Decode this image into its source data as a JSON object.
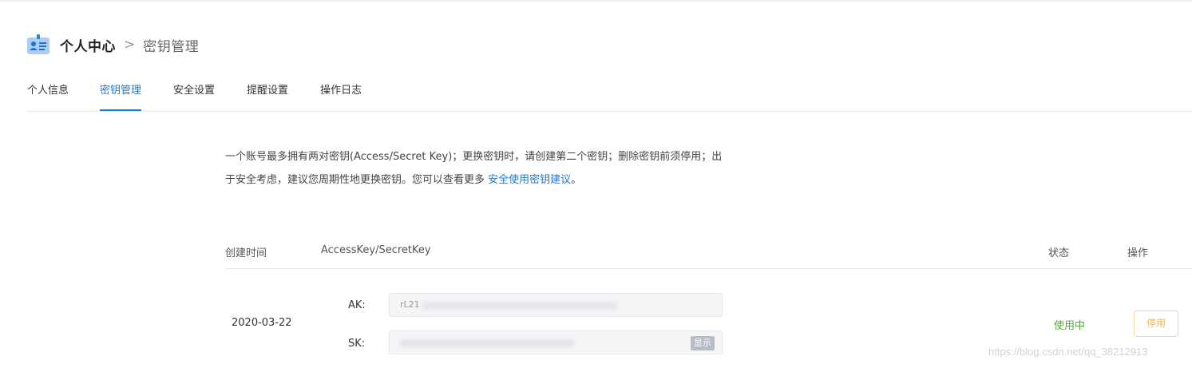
{
  "header": {
    "title": "个人中心",
    "separator": ">",
    "subtitle": "密钥管理",
    "icon": "id-card-icon"
  },
  "tabs": [
    {
      "label": "个人信息",
      "active": false
    },
    {
      "label": "密钥管理",
      "active": true
    },
    {
      "label": "安全设置",
      "active": false
    },
    {
      "label": "提醒设置",
      "active": false
    },
    {
      "label": "操作日志",
      "active": false
    }
  ],
  "notice": {
    "text": "一个账号最多拥有两对密钥(Access/Secret Key)；更换密钥时，请创建第二个密钥；删除密钥前须停用；出于安全考虑，建议您周期性地更换密钥。您可以查看更多 ",
    "link": "安全使用密钥建议",
    "suffix": "。"
  },
  "table": {
    "columns": {
      "created": "创建时间",
      "keys": "AccessKey/SecretKey",
      "status": "状态",
      "actions": "操作"
    },
    "rows": [
      {
        "created": "2020-03-22",
        "ak_label": "AK:",
        "ak_value": "rL21",
        "sk_label": "SK:",
        "sk_show": "显示",
        "status": "使用中",
        "action": "停用"
      }
    ]
  },
  "watermark": "https://blog.csdn.net/qq_38212913",
  "colors": {
    "accent": "#1a7ad6",
    "status_active": "#52a83b",
    "disable_button": "#e3b95f"
  }
}
